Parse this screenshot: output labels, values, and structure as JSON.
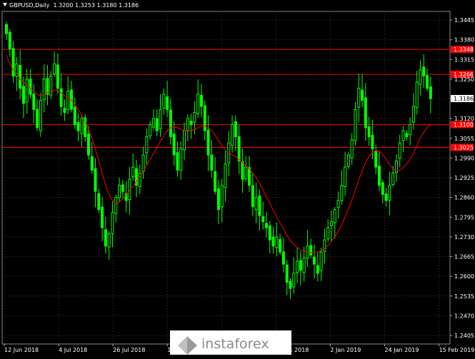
{
  "header": {
    "symbol": "GBPUSD,Daily",
    "ohlc": "1.3200 1.3253 1.3180 1.3186"
  },
  "watermark": "instaforex",
  "colors": {
    "background": "#000000",
    "grid": "#3a3a3a",
    "bull": "#00ff00",
    "bear": "#00ff00",
    "ma": "#ff0000",
    "level_line": "#ff0000",
    "axis_text": "#ffffff",
    "current_price_bg": "#ffffff"
  },
  "chart_data": {
    "type": "candlestick",
    "title": "GBPUSD,Daily",
    "ylim": [
      1.2405,
      1.3445
    ],
    "y_ticks": [
      "1.3445",
      "1.3380",
      "1.3315",
      "1.3250",
      "1.3185",
      "1.3120",
      "1.3055",
      "1.2990",
      "1.2925",
      "1.2860",
      "1.2795",
      "1.2730",
      "1.2665",
      "1.2600",
      "1.2535",
      "1.2470",
      "1.2405"
    ],
    "x_tick_labels": [
      "12 Jun 2018",
      "4 Jul 2018",
      "26 Jul 2018",
      "17 Aug 2018",
      "10 Sep 2018",
      "7 Dec 2018",
      "2 Jan 2019",
      "24 Jan 2019",
      "15 Feb 2019"
    ],
    "grid": true,
    "current_price": "1.3186",
    "horizontal_levels": [
      {
        "label": "1.3348",
        "value": 1.3348
      },
      {
        "label": "1.3266",
        "value": 1.3266
      },
      {
        "label": "1.3100",
        "value": 1.31
      },
      {
        "label": "1.3025",
        "value": 1.3025
      }
    ],
    "close_series": [
      1.34,
      1.335,
      1.326,
      1.33,
      1.322,
      1.317,
      1.325,
      1.32,
      1.315,
      1.309,
      1.318,
      1.325,
      1.32,
      1.326,
      1.33,
      1.322,
      1.316,
      1.314,
      1.321,
      1.315,
      1.31,
      1.308,
      1.312,
      1.306,
      1.3,
      1.295,
      1.288,
      1.282,
      1.276,
      1.27,
      1.274,
      1.281,
      1.286,
      1.29,
      1.288,
      1.285,
      1.292,
      1.296,
      1.29,
      1.294,
      1.3,
      1.306,
      1.31,
      1.312,
      1.308,
      1.315,
      1.32,
      1.315,
      1.306,
      1.3,
      1.295,
      1.302,
      1.308,
      1.312,
      1.31,
      1.314,
      1.32,
      1.316,
      1.308,
      1.3,
      1.295,
      1.288,
      1.282,
      1.29,
      1.297,
      1.304,
      1.31,
      1.306,
      1.298,
      1.292,
      1.296,
      1.29,
      1.283,
      1.286,
      1.28,
      1.278,
      1.276,
      1.272,
      1.27,
      1.273,
      1.268,
      1.264,
      1.258,
      1.256,
      1.261,
      1.265,
      1.262,
      1.266,
      1.27,
      1.267,
      1.264,
      1.261,
      1.268,
      1.272,
      1.276,
      1.278,
      1.282,
      1.285,
      1.29,
      1.296,
      1.3,
      1.305,
      1.315,
      1.322,
      1.318,
      1.309,
      1.306,
      1.302,
      1.296,
      1.29,
      1.287,
      1.285,
      1.29,
      1.294,
      1.298,
      1.304,
      1.308,
      1.306,
      1.31,
      1.316,
      1.324,
      1.328,
      1.326,
      1.322,
      1.3186
    ],
    "ma_series": [
      1.333,
      1.33,
      1.328,
      1.327,
      1.325,
      1.324,
      1.323,
      1.322,
      1.321,
      1.32,
      1.3195,
      1.32,
      1.3205,
      1.321,
      1.3215,
      1.3212,
      1.3205,
      1.3195,
      1.319,
      1.318,
      1.3165,
      1.315,
      1.313,
      1.311,
      1.3085,
      1.3055,
      1.302,
      1.298,
      1.294,
      1.29,
      1.287,
      1.285,
      1.284,
      1.2845,
      1.2855,
      1.2868,
      1.2882,
      1.2898,
      1.2912,
      1.2928,
      1.2946,
      1.2965,
      1.2985,
      1.3005,
      1.3025,
      1.3045,
      1.3065,
      1.308,
      1.309,
      1.3092,
      1.309,
      1.3085,
      1.308,
      1.3078,
      1.308,
      1.3085,
      1.309,
      1.3095,
      1.3095,
      1.309,
      1.308,
      1.3065,
      1.3048,
      1.303,
      1.3015,
      1.3005,
      1.3,
      1.2995,
      1.2985,
      1.2975,
      1.2965,
      1.2955,
      1.294,
      1.2925,
      1.2905,
      1.2885,
      1.2862,
      1.284,
      1.2818,
      1.2796,
      1.2775,
      1.2755,
      1.2735,
      1.2718,
      1.2705,
      1.2695,
      1.2688,
      1.2683,
      1.268,
      1.2678,
      1.2678,
      1.268,
      1.2685,
      1.2692,
      1.2702,
      1.2715,
      1.273,
      1.2748,
      1.277,
      1.2795,
      1.2822,
      1.2852,
      1.2885,
      1.2918,
      1.2948,
      1.2975,
      1.2995,
      1.3008,
      1.3015,
      1.3012,
      1.3002,
      1.2985,
      1.2968,
      1.2955,
      1.2948,
      1.295,
      1.2958,
      1.297,
      1.2985,
      1.3005,
      1.303,
      1.3055,
      1.3075,
      1.309,
      1.31
    ]
  }
}
